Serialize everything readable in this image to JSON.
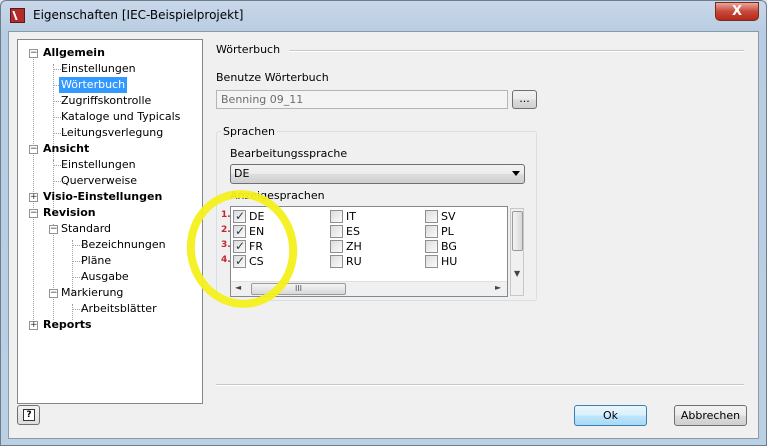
{
  "window": {
    "title": "Eigenschaften [IEC-Beispielprojekt]",
    "close_glyph": "X"
  },
  "tree": [
    {
      "label": "Allgemein",
      "bold": true,
      "expander": "−"
    },
    {
      "label": "Einstellungen"
    },
    {
      "label": "Wörterbuch",
      "selected": true
    },
    {
      "label": "Zugriffskontrolle"
    },
    {
      "label": "Kataloge und Typicals"
    },
    {
      "label": "Leitungsverlegung"
    },
    {
      "label": "Ansicht",
      "bold": true,
      "expander": "−"
    },
    {
      "label": "Einstellungen"
    },
    {
      "label": "Querverweise"
    },
    {
      "label": "Visio-Einstellungen",
      "bold": true,
      "expander": "+"
    },
    {
      "label": "Revision",
      "bold": true,
      "expander": "−"
    },
    {
      "label": "Standard",
      "expander": "−"
    },
    {
      "label": "Bezeichnungen"
    },
    {
      "label": "Pläne"
    },
    {
      "label": "Ausgabe"
    },
    {
      "label": "Markierung",
      "expander": "−"
    },
    {
      "label": "Arbeitsblätter"
    },
    {
      "label": "Reports",
      "bold": true,
      "expander": "+"
    }
  ],
  "panel": {
    "section_title": "Wörterbuch",
    "dictionary_label": "Benutze Wörterbuch",
    "dictionary_value": "Benning 09_11",
    "browse_label": "...",
    "languages_group": "Sprachen",
    "editing_language_label": "Bearbeitungssprache",
    "editing_language_value": "DE",
    "display_languages_label": "Anzeigesprachen",
    "languages": [
      {
        "code": "DE",
        "checked": true,
        "order": "1."
      },
      {
        "code": "EN",
        "checked": true,
        "order": "2."
      },
      {
        "code": "FR",
        "checked": true,
        "order": "3."
      },
      {
        "code": "CS",
        "checked": true,
        "order": "4."
      },
      {
        "code": "IT",
        "checked": false
      },
      {
        "code": "ES",
        "checked": false
      },
      {
        "code": "ZH",
        "checked": false
      },
      {
        "code": "RU",
        "checked": false
      },
      {
        "code": "SV",
        "checked": false
      },
      {
        "code": "PL",
        "checked": false
      },
      {
        "code": "BG",
        "checked": false
      },
      {
        "code": "HU",
        "checked": false
      }
    ],
    "scroll_thumb_grip": "III"
  },
  "footer": {
    "help_glyph": "?",
    "ok_label": "Ok",
    "cancel_label": "Abbrechen"
  },
  "colors": {
    "selection": "#3399ff",
    "annotation_circle": "#f4f01e",
    "order_numbers": "#c0282f"
  }
}
